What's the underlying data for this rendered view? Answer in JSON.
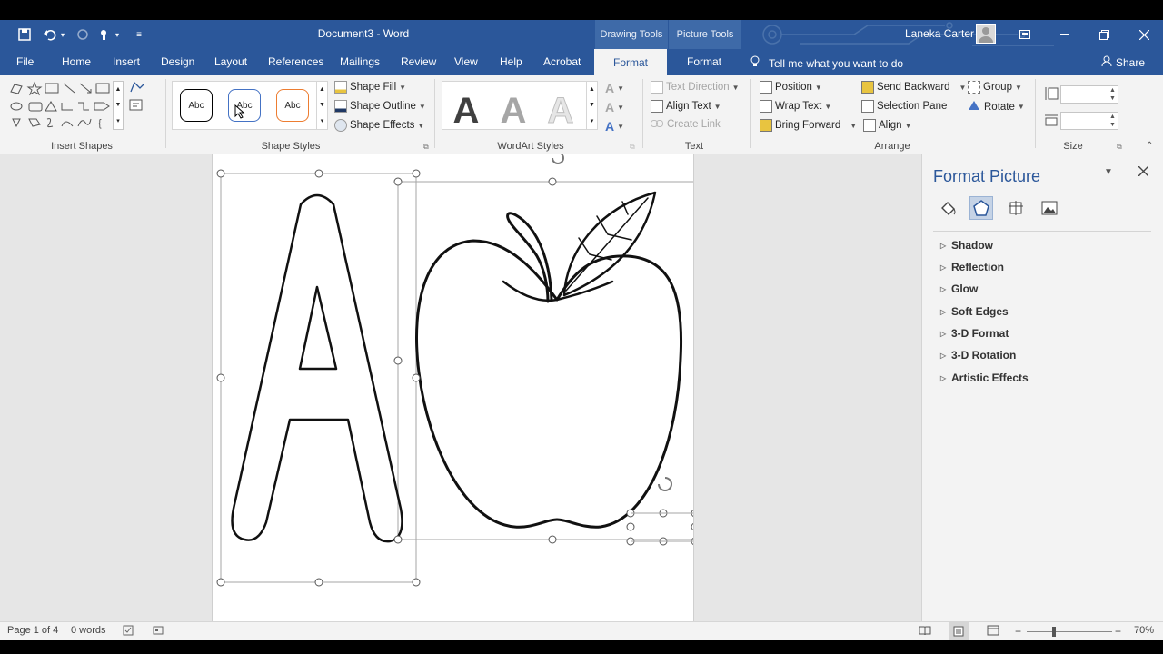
{
  "window": {
    "document_title": "Document3  -  Word",
    "context_groups": [
      "Drawing Tools",
      "Picture Tools"
    ],
    "user_name": "Laneka Carter"
  },
  "tabs": {
    "file": "File",
    "home": "Home",
    "insert": "Insert",
    "design": "Design",
    "layout": "Layout",
    "references": "References",
    "mailings": "Mailings",
    "review": "Review",
    "view": "View",
    "help": "Help",
    "acrobat": "Acrobat",
    "format_drawing": "Format",
    "format_picture": "Format",
    "tell_me": "Tell me what you want to do",
    "share": "Share"
  },
  "ribbon": {
    "insert_shapes_label": "Insert Shapes",
    "shape_styles_label": "Shape Styles",
    "shape_style_sample": "Abc",
    "shape_fill": "Shape Fill",
    "shape_outline": "Shape Outline",
    "shape_effects": "Shape Effects",
    "wordart_styles_label": "WordArt Styles",
    "wordart_sample": "A",
    "text_direction": "Text Direction",
    "align_text": "Align Text",
    "create_link": "Create Link",
    "text_label": "Text",
    "position": "Position",
    "wrap_text": "Wrap Text",
    "bring_forward": "Bring Forward",
    "send_backward": "Send Backward",
    "selection_pane": "Selection Pane",
    "align": "Align",
    "group": "Group",
    "rotate": "Rotate",
    "arrange_label": "Arrange",
    "size_label": "Size"
  },
  "pane": {
    "title": "Format Picture",
    "sections": [
      "Shadow",
      "Reflection",
      "Glow",
      "Soft Edges",
      "3-D Format",
      "3-D Rotation",
      "Artistic Effects"
    ]
  },
  "status": {
    "page": "Page 1 of 4",
    "words": "0 words",
    "zoom": "70%"
  },
  "colors": {
    "accent": "#2b579a",
    "ribbon_bg": "#f3f3f3"
  }
}
